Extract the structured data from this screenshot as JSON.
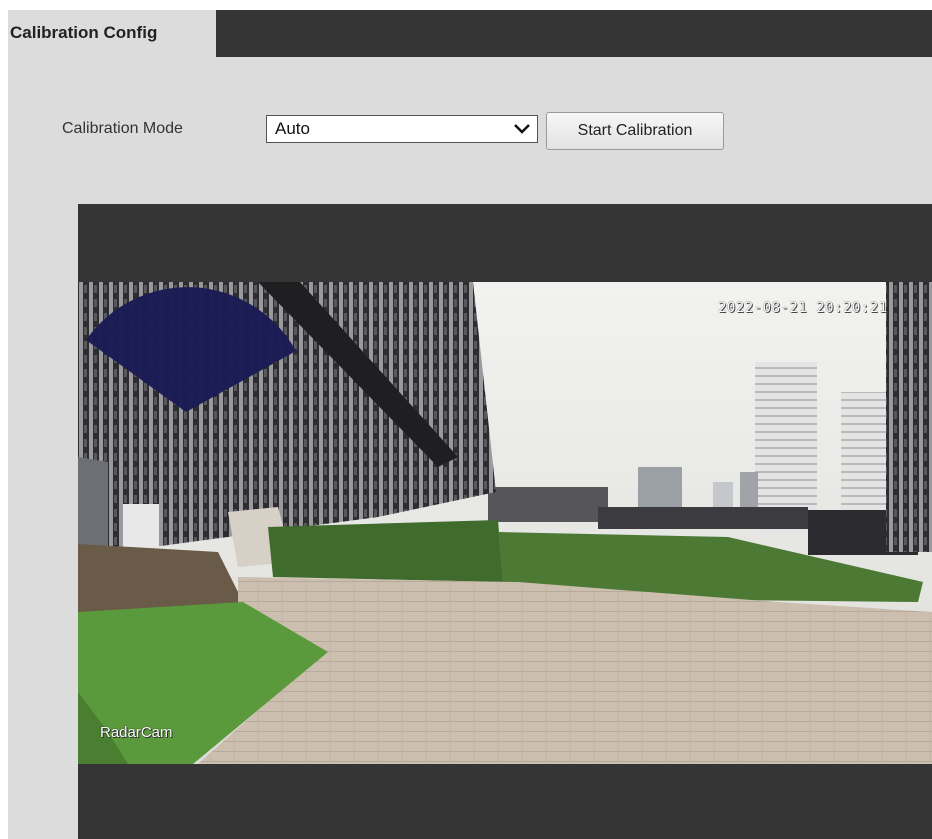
{
  "tabs": {
    "active_label": "Calibration Config"
  },
  "calibration": {
    "mode_label": "Calibration Mode",
    "mode_value": "Auto",
    "start_button": "Start Calibration"
  },
  "video": {
    "osd_timestamp": "2022-08-21 20:20:21",
    "osd_camera_name": "RadarCam"
  },
  "colors": {
    "radar_sector": "#1c1c55",
    "tab_bar": "#353535",
    "panel_bg": "#dcdcdc"
  }
}
